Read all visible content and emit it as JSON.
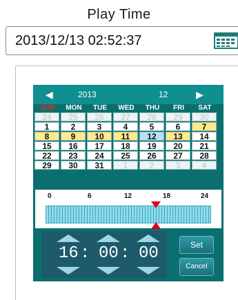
{
  "header": {
    "title": "Play Time"
  },
  "datetime_input": {
    "value": "2013/12/13 02:52:37"
  },
  "calendar": {
    "year": "2013",
    "month": "12",
    "prev_arrow": "◀",
    "next_arrow": "▶",
    "weekdays": [
      "SUN",
      "MON",
      "TUE",
      "WED",
      "THU",
      "FRI",
      "SAT"
    ],
    "rows": [
      [
        {
          "d": "24",
          "s": "other"
        },
        {
          "d": "25",
          "s": "other"
        },
        {
          "d": "26",
          "s": "other"
        },
        {
          "d": "27",
          "s": "other"
        },
        {
          "d": "28",
          "s": "other"
        },
        {
          "d": "29",
          "s": "other"
        },
        {
          "d": "30",
          "s": "other"
        }
      ],
      [
        {
          "d": "1",
          "s": ""
        },
        {
          "d": "2",
          "s": ""
        },
        {
          "d": "3",
          "s": ""
        },
        {
          "d": "4",
          "s": ""
        },
        {
          "d": "5",
          "s": ""
        },
        {
          "d": "6",
          "s": ""
        },
        {
          "d": "7",
          "s": "yellow"
        }
      ],
      [
        {
          "d": "8",
          "s": "yellow"
        },
        {
          "d": "9",
          "s": "yellow"
        },
        {
          "d": "10",
          "s": "yellow"
        },
        {
          "d": "11",
          "s": "yellow"
        },
        {
          "d": "12",
          "s": "blue"
        },
        {
          "d": "13",
          "s": "yellow"
        },
        {
          "d": "14",
          "s": ""
        }
      ],
      [
        {
          "d": "15",
          "s": ""
        },
        {
          "d": "16",
          "s": ""
        },
        {
          "d": "17",
          "s": ""
        },
        {
          "d": "18",
          "s": ""
        },
        {
          "d": "19",
          "s": ""
        },
        {
          "d": "20",
          "s": ""
        },
        {
          "d": "21",
          "s": ""
        }
      ],
      [
        {
          "d": "22",
          "s": ""
        },
        {
          "d": "23",
          "s": ""
        },
        {
          "d": "24",
          "s": ""
        },
        {
          "d": "25",
          "s": ""
        },
        {
          "d": "26",
          "s": ""
        },
        {
          "d": "27",
          "s": ""
        },
        {
          "d": "28",
          "s": ""
        }
      ],
      [
        {
          "d": "29",
          "s": ""
        },
        {
          "d": "30",
          "s": ""
        },
        {
          "d": "31",
          "s": ""
        },
        {
          "d": "1",
          "s": "other"
        },
        {
          "d": "2",
          "s": "other"
        },
        {
          "d": "3",
          "s": "other"
        },
        {
          "d": "4",
          "s": "other"
        }
      ]
    ]
  },
  "timeline": {
    "ticks": [
      "0",
      "6",
      "12",
      "18",
      "24"
    ],
    "marker_hour": 16
  },
  "time": {
    "hour": "16",
    "minute": "00",
    "second": "00",
    "separator": ":"
  },
  "buttons": {
    "set": "Set",
    "cancel": "Cancel"
  },
  "colors": {
    "panel_bg": "#0c6f6f",
    "header_bg": "#0f8f8f",
    "sunday": "#ff2020",
    "highlight_yellow": "#ffe98a",
    "highlight_blue": "#b6e3f3",
    "marker": "#e3001b"
  }
}
